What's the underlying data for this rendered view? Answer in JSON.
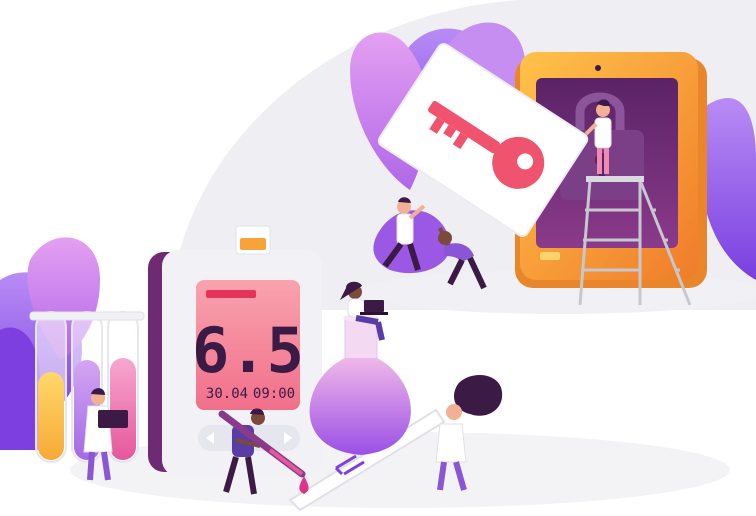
{
  "meter": {
    "reading": "6.5",
    "date": "30.04",
    "time": "09:00",
    "screen_color": "#f5788e",
    "body_color": "#f2f2f6",
    "side_color": "#6e2a73"
  },
  "palette": {
    "purple": "#a86ef0",
    "violet": "#7e3fe0",
    "pink": "#e0338a",
    "orange": "#f8a23a",
    "dark_plum": "#3b1a45",
    "arc_grey": "#eeeef2"
  },
  "icons": [
    "key-icon",
    "padlock-icon",
    "droplet-icon",
    "arrow-icon",
    "laptop-icon"
  ]
}
